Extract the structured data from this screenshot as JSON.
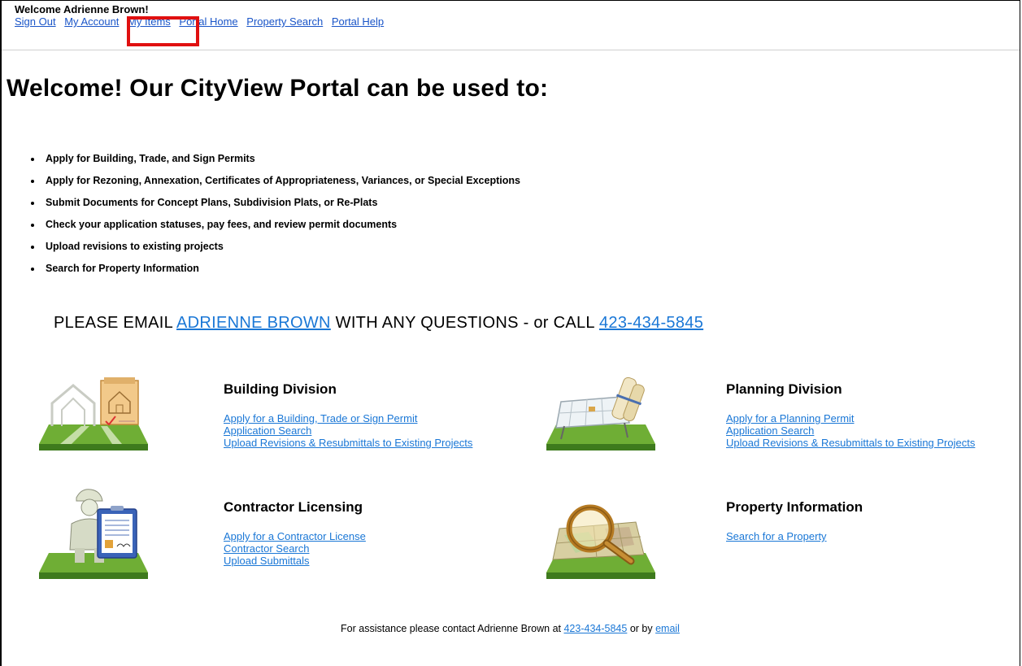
{
  "header": {
    "welcome": "Welcome Adrienne Brown!",
    "nav": {
      "sign_out": "Sign Out",
      "my_account": "My Account",
      "my_items": "My Items",
      "portal_home": "Portal Home",
      "property_search": "Property Search",
      "portal_help": "Portal Help"
    }
  },
  "main": {
    "title": "Welcome! Our CityView Portal can be used to:",
    "features": [
      "Apply for Building, Trade, and Sign Permits",
      "Apply for Rezoning, Annexation, Certificates of Appropriateness, Variances, or Special Exceptions",
      "Submit Documents for Concept Plans, Subdivision Plats, or Re-Plats",
      "Check your application statuses, pay fees, and review permit documents",
      "Upload revisions to existing projects",
      "Search for Property Information"
    ],
    "contact": {
      "prefix": "PLEASE EMAIL ",
      "name_link": "ADRIENNE BROWN",
      "middle": " WITH ANY QUESTIONS - or CALL ",
      "phone_link": "423-434-5845"
    }
  },
  "sections": {
    "building": {
      "title": "Building Division",
      "links": [
        "Apply for a Building, Trade or Sign Permit",
        "Application Search",
        "Upload Revisions & Resubmittals to Existing Projects"
      ]
    },
    "planning": {
      "title": "Planning Division",
      "links": [
        "Apply for a Planning Permit",
        "Application Search",
        "Upload Revisions & Resubmittals to Existing Projects"
      ]
    },
    "contractor": {
      "title": "Contractor Licensing",
      "links": [
        "Apply for a Contractor License",
        "Contractor Search",
        "Upload Submittals"
      ]
    },
    "property": {
      "title": "Property Information",
      "links": [
        "Search for a Property"
      ]
    }
  },
  "footer": {
    "prefix": "For assistance please contact Adrienne Brown at ",
    "phone": "423-434-5845",
    "middle": " or by ",
    "email": "email"
  },
  "colors": {
    "link": "#1a77d6",
    "highlight": "#e01010",
    "grass": "#5b9e2b"
  }
}
